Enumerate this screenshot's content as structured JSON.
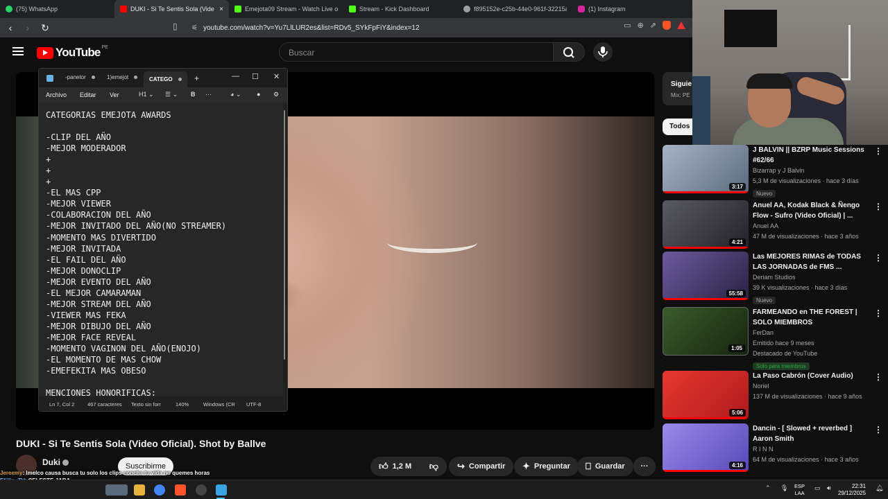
{
  "browser": {
    "tabs": [
      {
        "label": "(75) WhatsApp",
        "favicon_color": "#25d366",
        "active": false
      },
      {
        "label": "DUKI - Si Te Sentis Sola (Vide",
        "favicon_color": "#ff0000",
        "active": true
      },
      {
        "label": "Emejota09 Stream - Watch Live o",
        "favicon_color": "#53fc18",
        "active": false
      },
      {
        "label": "Stream - Kick Dashboard",
        "favicon_color": "#53fc18",
        "active": false
      },
      {
        "label": "f895152e-c25b-44e0-961f-32215ac2",
        "favicon_color": "#9aa0a6",
        "active": false
      },
      {
        "label": "(1) Instagram",
        "favicon_color": "#d6249f",
        "active": false
      }
    ],
    "close_glyph": "×",
    "url": "youtube.com/watch?v=Yu7LlLUR2es&list=RDv5_SYkFpFiY&index=12"
  },
  "youtube": {
    "logo_word": "YouTube",
    "country_code": "PE",
    "search_placeholder": "Buscar",
    "video_title": "DUKI - Si Te Sentis Sola (Video Oficial). Shot by Ballve",
    "channel": "Duki",
    "subscribe_label": "Suscribirme",
    "actions": {
      "likes": "1,2 M",
      "share": "Compartir",
      "ask": "Preguntar",
      "save": "Guardar"
    },
    "sidebar": {
      "top_chip_title": "Siguie",
      "top_chip_sub": "Mix: PE",
      "filter_chip": "Todos",
      "recommendations": [
        {
          "title": "J BALVIN || BZRP Music Sessions #62/66",
          "channel": "Bizarrap  y J Balvin",
          "stats": "5,3 M de visualizaciones · hace 3 días",
          "badge": "Nuevo",
          "duration": "3:17",
          "thumb_color": "#6f7e92"
        },
        {
          "title": "Anuel AA, Kodak Black & Ñengo Flow - Sufro (Video Oficial) | ...",
          "channel": "Anuel AA",
          "stats": "47 M de visualizaciones · hace 3 años",
          "badge": "",
          "duration": "4:21",
          "thumb_color": "#3b3a3c"
        },
        {
          "title": "Las MEJORES RIMAS de TODAS LAS JORNADAS de FMS ...",
          "channel": "Deriam Studios",
          "stats": "39 K visualizaciones · hace 3 días",
          "badge": "Nuevo",
          "duration": "55:58",
          "thumb_color": "#4a3d6a"
        },
        {
          "title": "FARMEANDO en THE FOREST | SOLO MIEMBROS",
          "channel": "FerDan",
          "stats": "Emitido hace 9 meses",
          "stats2": "Destacado de YouTube",
          "member": "Solo para miembros",
          "duration": "1:05",
          "thumb_color": "#2c4a22"
        },
        {
          "title": "La Paso Cabrón (Cover Audio)",
          "channel": "Noriel",
          "stats": "137 M de visualizaciones · hace 9 años",
          "badge": "",
          "duration": "5:06",
          "thumb_color": "#d8232a"
        },
        {
          "title": "Dancin - [ Slowed + reverbed ] Aaron Smith",
          "channel": "R I N N",
          "stats": "64 M de visualizaciones · hace 3 años",
          "badge": "",
          "duration": "4:16",
          "thumb_color": "#7c6ad8"
        }
      ]
    }
  },
  "notepad": {
    "tabs": [
      "-panetor",
      "1)emejot",
      "CATEGO"
    ],
    "menu": [
      "Archivo",
      "Editar",
      "Ver"
    ],
    "heading_level": "H1",
    "bold_label": "B",
    "lines": [
      "CATEGORIAS EMEJOTA AWARDS",
      "",
      "-CLIP DEL AÑO",
      "-MEJOR MODERADOR",
      "+",
      "+",
      "+",
      "-EL MAS CPP",
      "-MEJOR VIEWER",
      "-COLABORACION DEL AÑO",
      "-MEJOR INVITADO DEL AÑO(NO STREAMER)",
      "-MOMENTO MAS DIVERTIDO",
      "-MEJOR INVITADA",
      "-EL FAIL DEL AÑO",
      "-MEJOR DONOCLIP",
      "-MEJOR EVENTO DEL AÑO",
      "-EL MEJOR CAMARAMAN",
      "-MEJOR STREAM DEL AÑO",
      "-VIEWER MAS FEKA",
      "-MEJOR DIBUJO DEL AÑO",
      "-MEJOR FACE REVEAL",
      "-MOMENTO VAGINON DEL AÑO(ENOJO)",
      "-EL MOMENTO DE MAS CHOW",
      "-EMEFEKITA MAS OBESO",
      "",
      "MENCIONES HONORIFICAS:"
    ],
    "status": {
      "position": "Ln 7, Col 2",
      "chars": "467 caracteres",
      "format": "Texto sin forr",
      "zoom": "140%",
      "eol": "Windows (CR",
      "encoding": "UTF-8"
    }
  },
  "chat": [
    {
      "user": "Jereemy",
      "text": ": Imelco causa busca tu solo los clips concha tu vida no quemes horas"
    },
    {
      "user": "Eliilin_TV",
      "text": ": CELESTE JARA"
    }
  ],
  "taskbar": {
    "lang_top": "ESP",
    "lang_bottom": "LAA",
    "time": "22:31",
    "date": "29/12/2025"
  }
}
